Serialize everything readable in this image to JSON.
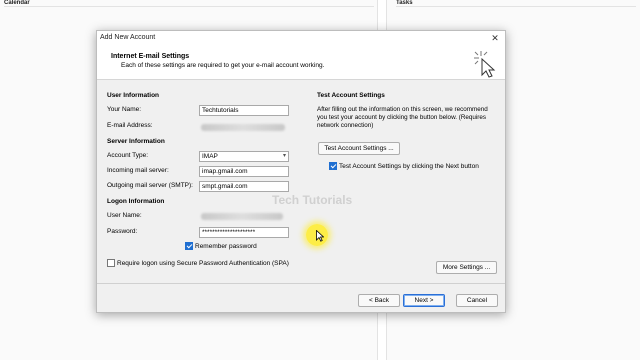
{
  "background": {
    "calendar_header": "Calendar",
    "tasks_header": "Tasks"
  },
  "dialog": {
    "title": "Add New Account",
    "close_glyph": "✕",
    "header": {
      "title": "Internet E-mail Settings",
      "subtitle": "Each of these settings are required to get your e-mail account working."
    },
    "user_info": {
      "section": "User Information",
      "your_name_label": "Your Name:",
      "your_name_value": "Techtutorials",
      "email_label": "E-mail Address:"
    },
    "server_info": {
      "section": "Server Information",
      "account_type_label": "Account Type:",
      "account_type_value": "IMAP",
      "incoming_label": "Incoming mail server:",
      "incoming_value": "imap.gmail.com",
      "outgoing_label": "Outgoing mail server (SMTP):",
      "outgoing_value": "smpt.gmail.com"
    },
    "logon_info": {
      "section": "Logon Information",
      "username_label": "User Name:",
      "password_label": "Password:",
      "password_value": "*********************",
      "remember_password_label": "Remember password",
      "remember_password_checked": true,
      "spa_label": "Require logon using Secure Password Authentication (SPA)",
      "spa_checked": false
    },
    "test": {
      "section": "Test Account Settings",
      "description": "After filling out the information on this screen, we recommend you test your account by clicking the button below. (Requires network connection)",
      "test_button": "Test Account Settings ...",
      "auto_test_label": "Test Account Settings by clicking the Next button",
      "auto_test_checked": true
    },
    "buttons": {
      "more_settings": "More Settings ...",
      "back": "< Back",
      "next": "Next >",
      "cancel": "Cancel"
    }
  },
  "watermark": "Tech Tutorials",
  "colors": {
    "accent": "#1f6fd1",
    "cursor_highlight": "#ffec28"
  }
}
